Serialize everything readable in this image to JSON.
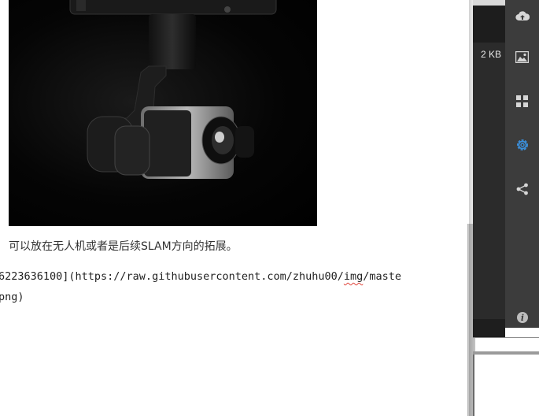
{
  "document": {
    "image_alt": "gimbal camera photo",
    "caption": "可以放在无人机或者是后续SLAM方向的拓展。",
    "code_line_1_a": "6223636100](https://raw.githubusercontent.com/zhuhu00/",
    "code_line_1_b": "img",
    "code_line_1_c": "/maste",
    "code_line_2": "png)"
  },
  "side_panel": {
    "file_size": "2 KB"
  },
  "rail": {
    "icons": [
      "cloud-upload-icon",
      "image-icon",
      "grid-icon",
      "settings-icon",
      "share-icon",
      "info-icon"
    ],
    "active_icon": "settings-icon"
  },
  "colors": {
    "active": "#3b8fdb",
    "rail_bg": "#3c3c3c",
    "icon": "#d6d6d6"
  }
}
